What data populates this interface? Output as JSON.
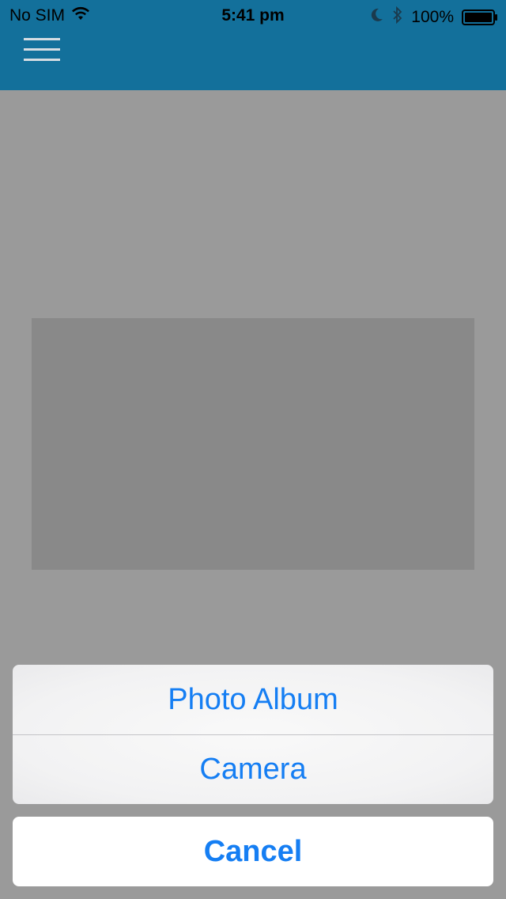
{
  "status_bar": {
    "carrier": "No SIM",
    "time": "5:41 pm",
    "battery_percent": "100%",
    "icons": [
      "wifi-icon",
      "moon-icon",
      "bluetooth-icon",
      "battery-icon"
    ]
  },
  "nav": {
    "menu_icon": "hamburger-menu-icon"
  },
  "action_sheet": {
    "options": [
      "Photo Album",
      "Camera"
    ],
    "cancel_label": "Cancel"
  },
  "colors": {
    "header": "#13709b",
    "overlay_background": "#9a9a9a",
    "placeholder": "#898989",
    "action_text": "#157ef3"
  }
}
